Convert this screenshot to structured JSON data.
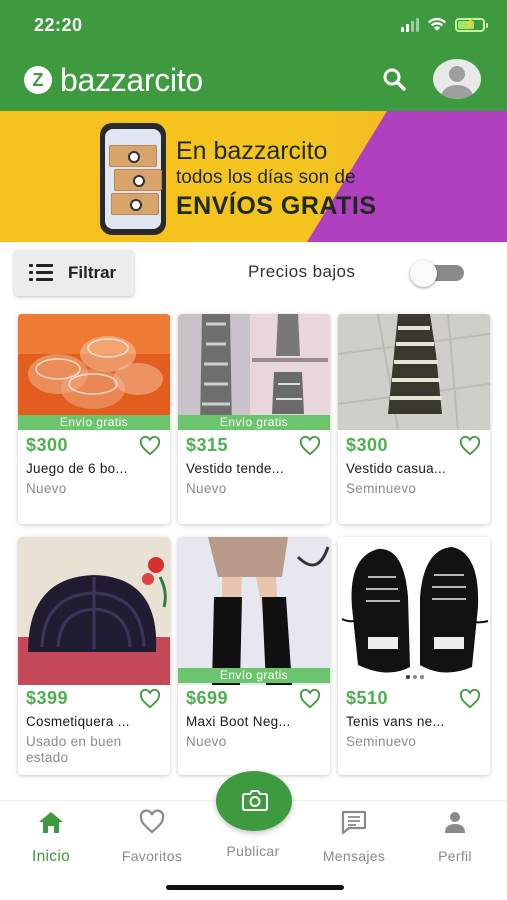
{
  "status_bar": {
    "time": "22:20",
    "battery_icon": "battery-charging-icon",
    "wifi_icon": "wifi-icon",
    "signal_icon": "signal-icon"
  },
  "app_bar": {
    "logo_mark": "Z",
    "title": "bazzarcito",
    "search_icon": "search-icon",
    "avatar_icon": "user-avatar-icon",
    "brand_color": "#3e9a3e"
  },
  "banner": {
    "line1": "En bazzarcito",
    "line2": "todos los días son de",
    "line3": "ENVÍOS GRATIS"
  },
  "filters": {
    "filter_label": "Filtrar",
    "filter_icon": "filter-list-icon",
    "toggle_label": "Precios bajos",
    "toggle_on": false
  },
  "products": [
    {
      "price": "$300",
      "title": "Juego de 6 bo...",
      "condition": "Nuevo",
      "free_shipping": "Envío gratis"
    },
    {
      "price": "$315",
      "title": "Vestido tende...",
      "condition": "Nuevo",
      "free_shipping": "Envío gratis"
    },
    {
      "price": "$300",
      "title": "Vestido casua...",
      "condition": "Seminuevo",
      "free_shipping": ""
    },
    {
      "price": "$399",
      "title": "Cosmetiquera ...",
      "condition": "Usado en buen estado",
      "free_shipping": ""
    },
    {
      "price": "$699",
      "title": "Maxi Boot Neg...",
      "condition": "Nuevo",
      "free_shipping": "Envío gratis"
    },
    {
      "price": "$510",
      "title": "Tenis vans ne...",
      "condition": "Seminuevo",
      "free_shipping": ""
    }
  ],
  "bottom_nav": {
    "items": [
      {
        "label": "Inicio",
        "icon": "home-icon",
        "active": true
      },
      {
        "label": "Favoritos",
        "icon": "heart-icon",
        "active": false
      },
      {
        "label": "Publicar",
        "icon": "camera-icon",
        "active": false
      },
      {
        "label": "Mensajes",
        "icon": "message-icon",
        "active": false
      },
      {
        "label": "Perfil",
        "icon": "person-icon",
        "active": false
      }
    ]
  }
}
